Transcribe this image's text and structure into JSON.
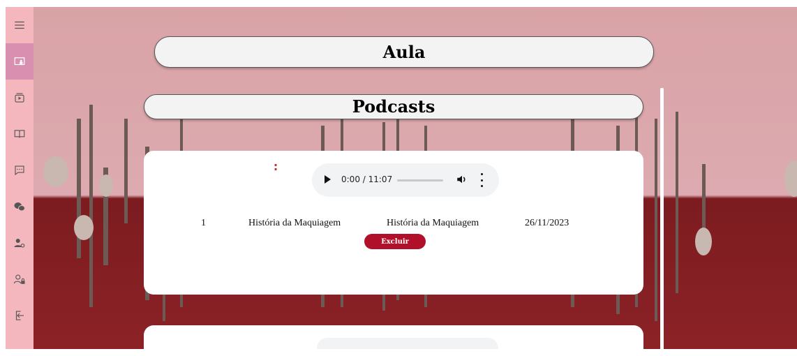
{
  "sidebar": {
    "items": [
      {
        "name": "menu-icon"
      },
      {
        "name": "class-icon",
        "active": true
      },
      {
        "name": "video-library-icon"
      },
      {
        "name": "book-icon"
      },
      {
        "name": "chat-icon"
      },
      {
        "name": "wechat-icon"
      },
      {
        "name": "user-settings-icon"
      },
      {
        "name": "user-lock-icon"
      },
      {
        "name": "logout-icon"
      }
    ]
  },
  "header": {
    "title": "Aula"
  },
  "section": {
    "title": "Podcasts"
  },
  "podcast": {
    "player": {
      "time": "0:00 / 11:07"
    },
    "id": "1",
    "title": "História da Maquiagem",
    "description": "História da Maquiagem",
    "date": "26/11/2023",
    "delete_label": "Excluir"
  },
  "colors": {
    "sidebar_bg": "#f3b7bd",
    "sidebar_active": "#d88fb0",
    "delete_button": "#b0102a",
    "wall_top": "#dcaab0",
    "wall_bottom": "#8b2226"
  }
}
